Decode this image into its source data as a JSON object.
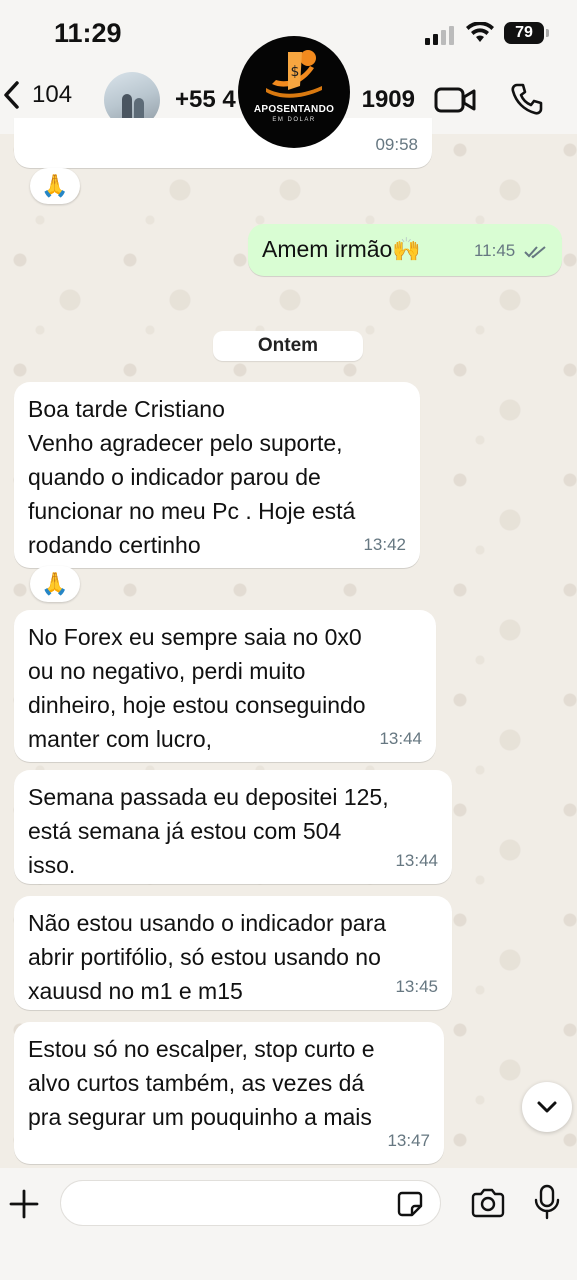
{
  "status_bar": {
    "time": "11:29",
    "battery": "79"
  },
  "header": {
    "back_count": "104",
    "contact_prefix": "+55 4",
    "contact_suffix": "1909",
    "logo_line1": "APOSENTANDO",
    "logo_line2": "EM DOLAR"
  },
  "messages": {
    "m0": {
      "time": "09:58"
    },
    "r1": {
      "emoji": "🙏"
    },
    "m1": {
      "text": "Amem irmão🙌",
      "time": "11:45"
    },
    "date_separator": "Ontem",
    "m2": {
      "text": "Boa tarde Cristiano\nVenho agradecer pelo suporte,\nquando o indicador parou de\nfuncionar no meu Pc . Hoje está\nrodando certinho",
      "time": "13:42"
    },
    "r2": {
      "emoji": "🙏"
    },
    "m3": {
      "text": "No Forex eu sempre saia no 0x0\nou no negativo, perdi muito\ndinheiro, hoje estou conseguindo\nmanter com lucro,",
      "time": "13:44"
    },
    "m4": {
      "text": "Semana passada eu depositei 125,\nestá semana já estou com 504\nisso.",
      "time": "13:44"
    },
    "m5": {
      "text": "Não estou usando o indicador para\nabrir portifólio, só estou usando no\nxauusd no m1 e m15",
      "time": "13:45"
    },
    "m6": {
      "text": "Estou só no escalper, stop curto e\nalvo curtos também, as vezes dá\npra segurar um pouquinho a mais",
      "time": "13:47"
    }
  },
  "icons": {
    "back": "chevron-left-icon",
    "video": "video-call-icon",
    "phone": "phone-icon",
    "plus": "plus-icon",
    "sticker": "sticker-icon",
    "camera": "camera-icon",
    "mic": "microphone-icon",
    "scroll": "chevron-down-icon"
  },
  "colors": {
    "incoming": "#ffffff",
    "outgoing": "#d9fdd3",
    "read_ticks": "#667781"
  }
}
